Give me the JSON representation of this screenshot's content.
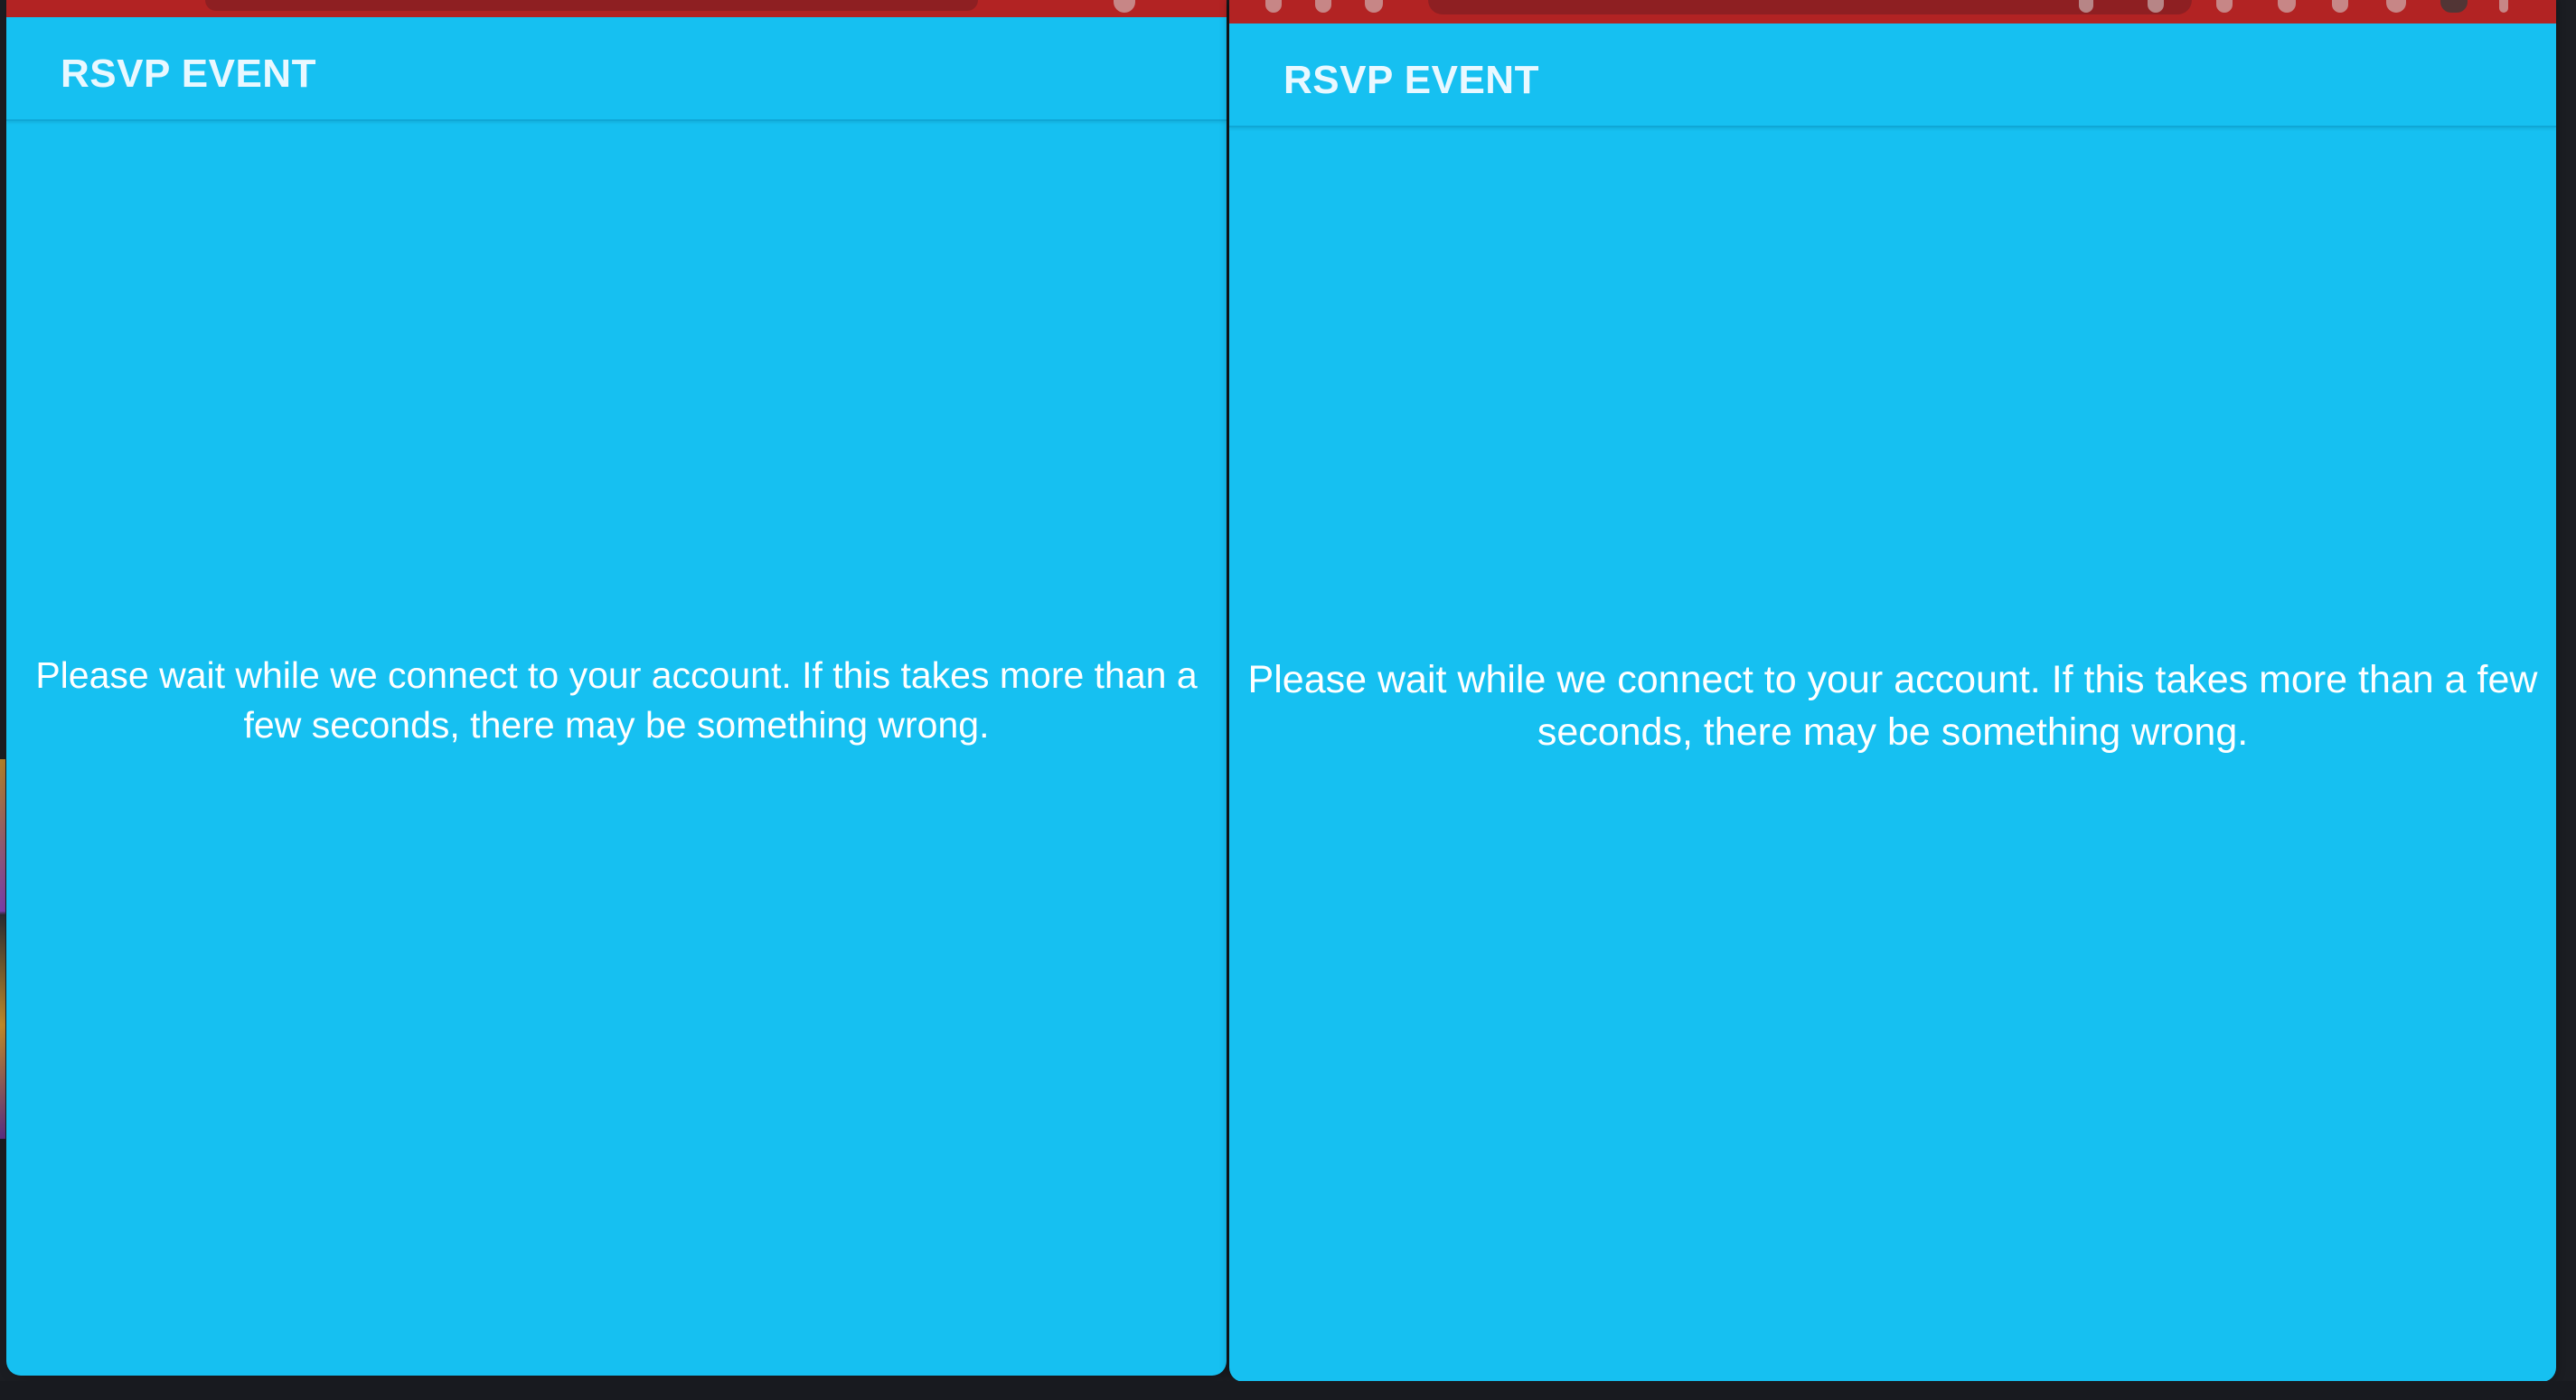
{
  "windows": [
    {
      "app_title": "RSVP EVENT",
      "message": "Please wait while we connect to your account. If this takes more than a few seconds, there may be something wrong."
    },
    {
      "app_title": "RSVP EVENT",
      "message": "Please wait while we connect to your account. If this takes more than a few seconds, there may be something wrong."
    }
  ],
  "colors": {
    "app_background": "#16c0f1",
    "browser_chrome": "#b22323",
    "desktop_background": "#1b1d22"
  }
}
